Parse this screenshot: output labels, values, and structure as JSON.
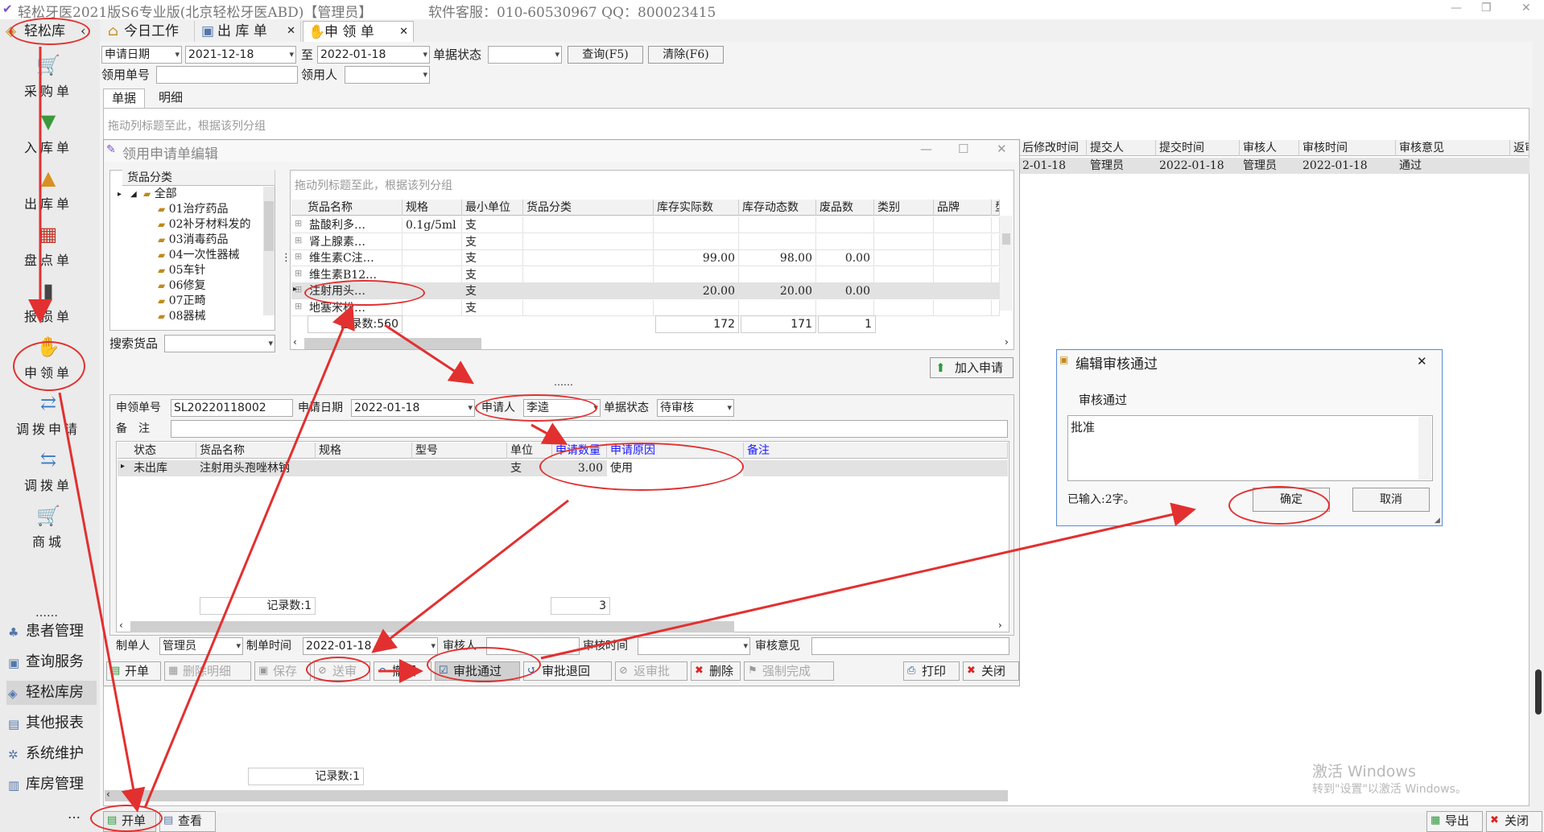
{
  "window": {
    "title": "轻松牙医2021版S6专业版(北京轻松牙医ABD)【管理员】",
    "support": "软件客服：010-60530967 QQ：800023415"
  },
  "sidebar": {
    "brand": "轻松库",
    "items": [
      {
        "label": "采购单",
        "icon": "cart-icon"
      },
      {
        "label": "入库单",
        "icon": "inbound-icon"
      },
      {
        "label": "出库单",
        "icon": "outbound-icon"
      },
      {
        "label": "盘点单",
        "icon": "inventory-icon"
      },
      {
        "label": "报损单",
        "icon": "damage-report-icon"
      },
      {
        "label": "申领单",
        "icon": "hand-icon"
      },
      {
        "label": "调拨申请",
        "icon": "transfer-request-icon"
      },
      {
        "label": "调拨单",
        "icon": "transfer-icon"
      },
      {
        "label": "商城",
        "icon": "shop-icon"
      }
    ],
    "more": "……",
    "groups": [
      "患者管理",
      "查询服务",
      "轻松库房",
      "其他报表",
      "系统维护",
      "库房管理"
    ],
    "dots": "…"
  },
  "tabs": [
    "今日工作",
    "出 库 单",
    "申 领 单"
  ],
  "filters": {
    "date_type": "申请日期",
    "date_from": "2021-12-18",
    "to_label": "至",
    "date_to": "2022-01-18",
    "status_label": "单据状态",
    "status_value": "",
    "query_btn": "查询(F5)",
    "clear_btn": "清除(F6)",
    "req_no_label": "领用单号",
    "req_no_value": "",
    "user_label": "领用人",
    "user_value": ""
  },
  "subtabs": [
    "单据",
    "明细"
  ],
  "group_hint": "拖动列标题至此，根据该列分组",
  "main_grid": {
    "headers": [
      "后修改时间",
      "提交人",
      "提交时间",
      "审核人",
      "审核时间",
      "审核意见",
      "返审"
    ],
    "row": [
      "2-01-18",
      "管理员",
      "2022-01-18",
      "管理员",
      "2022-01-18",
      "通过",
      ""
    ],
    "footer": "记录数:1"
  },
  "editor": {
    "title": "领用申请单编辑",
    "category_header": "货品分类",
    "categories": [
      "全部",
      "01治疗药品",
      "02补牙材料发的",
      "03消毒药品",
      "04一次性器械",
      "05车针",
      "06修复",
      "07正畸",
      "08器械"
    ],
    "search_label": "搜索货品",
    "search_value": "",
    "goods_group_hint": "拖动列标题至此，根据该列分组",
    "goods_headers": [
      "货品名称",
      "规格",
      "最小单位",
      "货品分类",
      "库存实际数",
      "库存动态数",
      "废品数",
      "类别",
      "品牌",
      "型号"
    ],
    "goods_rows": [
      [
        "盐酸利多…",
        "0.1g/5ml",
        "支",
        "",
        "",
        "",
        "",
        "",
        "",
        ""
      ],
      [
        "肾上腺素…",
        "",
        "支",
        "",
        "",
        "",
        "",
        "",
        "",
        ""
      ],
      [
        "维生素C注…",
        "",
        "支",
        "",
        "99.00",
        "98.00",
        "0.00",
        "",
        "",
        ""
      ],
      [
        "维生素B12…",
        "",
        "支",
        "",
        "",
        "",
        "",
        "",
        "",
        ""
      ],
      [
        "注射用头…",
        "",
        "支",
        "",
        "20.00",
        "20.00",
        "0.00",
        "",
        "",
        ""
      ],
      [
        "地塞米松…",
        "",
        "支",
        "",
        "",
        "",
        "",
        "",
        "",
        ""
      ]
    ],
    "goods_count": "记录数:560",
    "sum_actual": "172",
    "sum_dynamic": "171",
    "sum_waste": "1",
    "add_btn": "加入申请",
    "splitter": "……",
    "form": {
      "no_label": "申领单号",
      "no_value": "SL20220118002",
      "date_label": "申请日期",
      "date_value": "2022-01-18",
      "applicant_label": "申请人",
      "applicant_value": "李逵",
      "status_label": "单据状态",
      "status_value": "待审核",
      "remark_label": "备　注",
      "remark_value": ""
    },
    "detail_headers": [
      "状态",
      "货品名称",
      "规格",
      "型号",
      "单位",
      "申请数量",
      "申请原因",
      "备注"
    ],
    "detail_row": [
      "未出库",
      "注射用头孢唑林钠",
      "",
      "",
      "支",
      "3.00",
      "使用",
      ""
    ],
    "detail_count": "记录数:1",
    "detail_sum": "3",
    "bottom": {
      "maker_label": "制单人",
      "maker_value": "管理员",
      "make_time_label": "制单时间",
      "make_time_value": "2022-01-18",
      "auditor_label": "审核人",
      "auditor_value": "",
      "audit_time_label": "审核时间",
      "audit_time_value": "",
      "opinion_label": "审核意见",
      "opinion_value": ""
    },
    "toolbar": [
      "开单",
      "删除明细",
      "保存",
      "送审",
      "撤回",
      "审批通过",
      "审批退回",
      "返审批",
      "删除",
      "强制完成",
      "打印",
      "关闭"
    ]
  },
  "dialog": {
    "title": "编辑审核通过",
    "label": "审核通过",
    "text": "批准",
    "counter": "已输入:2字。",
    "ok": "确定",
    "cancel": "取消"
  },
  "footer": {
    "new_btn": "开单",
    "view_btn": "查看",
    "export_btn": "导出",
    "close_btn": "关闭"
  },
  "watermark": {
    "line1": "激活 Windows",
    "line2": "转到\"设置\"以激活 Windows。"
  },
  "colors": {
    "annotation_red": "#e23030",
    "header_blue": "#1a1aff"
  }
}
